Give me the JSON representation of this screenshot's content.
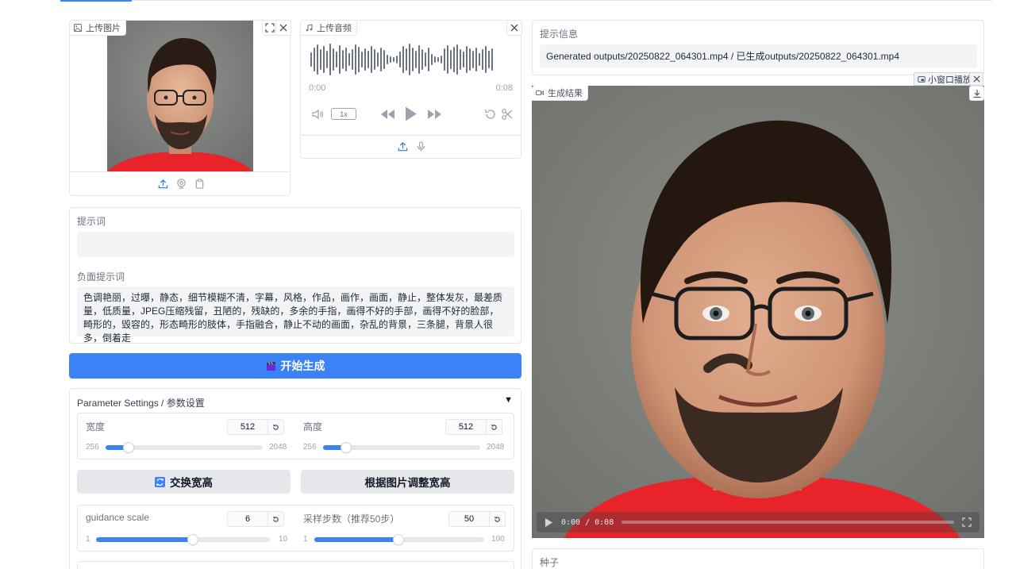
{
  "image_input": {
    "tag": "上传图片"
  },
  "audio_input": {
    "tag": "上传音频",
    "time_current": "0:00",
    "time_total": "0:08",
    "speed": "1x"
  },
  "prompt": {
    "label": "提示词",
    "value": ""
  },
  "negative_prompt": {
    "label": "负面提示词",
    "value": "色调艳丽，过曝，静态，细节模糊不清，字幕，风格，作品，画作，画面，静止，整体发灰，最差质量，低质量，JPEG压缩残留，丑陋的，残缺的，多余的手指，画得不好的手部，画得不好的脸部，畸形的，毁容的，形态畸形的肢体，手指融合，静止不动的画面，杂乱的背景，三条腿，背景人很多，倒着走"
  },
  "generate_button": {
    "label": "开始生成",
    "icon": "clapperboard-icon"
  },
  "params": {
    "title": "Parameter Settings / 参数设置",
    "toggle": "▼",
    "width": {
      "label": "宽度",
      "value": "512",
      "min": "256",
      "max": "2048",
      "fraction": 0.146
    },
    "height": {
      "label": "高度",
      "value": "512",
      "min": "256",
      "max": "2048",
      "fraction": 0.146
    },
    "swap_button": "交换宽高",
    "swap_icon": "swap-icon",
    "fit_button": "根据图片调整宽高",
    "guidance": {
      "label": "guidance scale",
      "value": "6",
      "min": "1",
      "max": "10",
      "fraction": 0.556
    },
    "steps": {
      "label": "采样步数（推荐50步）",
      "value": "50",
      "min": "1",
      "max": "100",
      "fraction": 0.495
    }
  },
  "info": {
    "label": "提示信息",
    "value": "Generated outputs/20250822_064301.mp4 / 已生成outputs/20250822_064301.mp4"
  },
  "result": {
    "tag": "生成结果",
    "mini_player": "小窗口播放",
    "time": "0:00 / 0:08"
  },
  "seed": {
    "label": "种子"
  },
  "colors": {
    "accent": "#3b82f6",
    "shirt": "#e8242a"
  }
}
